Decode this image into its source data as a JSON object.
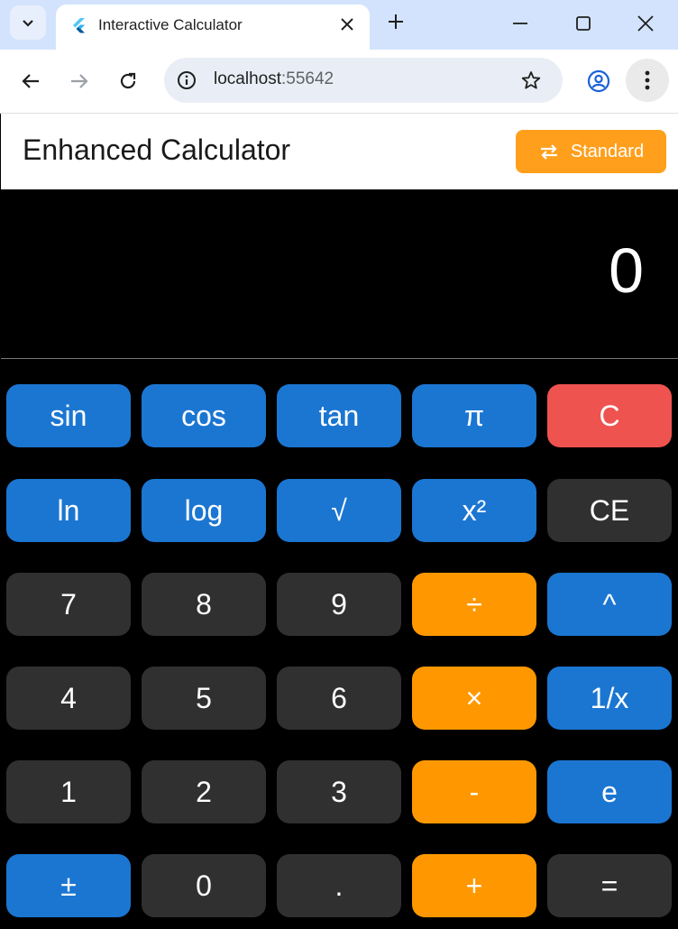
{
  "browser": {
    "tab_title": "Interactive Calculator",
    "url_host": "localhost",
    "url_port": ":55642"
  },
  "app": {
    "title": "Enhanced Calculator",
    "mode_label": "Standard"
  },
  "display": {
    "value": "0"
  },
  "keys": [
    [
      "sin",
      "cos",
      "tan",
      "π",
      "C"
    ],
    [
      "ln",
      "log",
      "√",
      "x²",
      "CE"
    ],
    [
      "7",
      "8",
      "9",
      "÷",
      "^"
    ],
    [
      "4",
      "5",
      "6",
      "×",
      "1/x"
    ],
    [
      "1",
      "2",
      "3",
      "-",
      "e"
    ],
    [
      "±",
      "0",
      ".",
      "+",
      "="
    ]
  ],
  "colors": {
    "blue": "#1b76d2",
    "dark": "#303030",
    "orange": "#ff9800",
    "red": "#ef5350",
    "mode_button": "#ff9f1c"
  }
}
